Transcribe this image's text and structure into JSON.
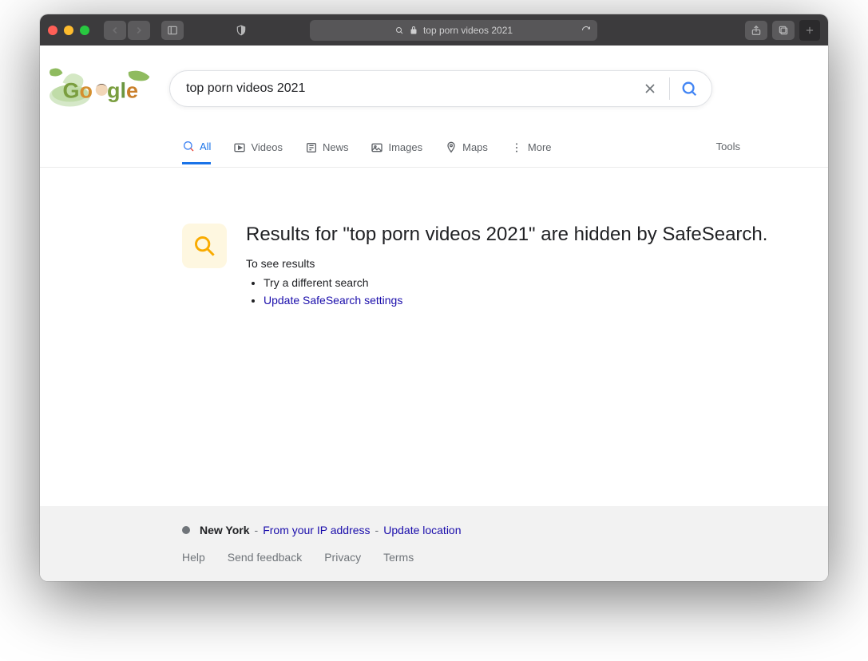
{
  "browser": {
    "address_text": "top porn videos 2021"
  },
  "search": {
    "query": "top porn videos 2021"
  },
  "tabs": {
    "all": "All",
    "videos": "Videos",
    "news": "News",
    "images": "Images",
    "maps": "Maps",
    "more": "More",
    "tools": "Tools"
  },
  "safesearch": {
    "heading": "Results for \"top porn videos 2021\" are hidden by SafeSearch.",
    "sub": "To see results",
    "bullet1": "Try a different search",
    "bullet2": "Update SafeSearch settings"
  },
  "footer": {
    "location": "New York",
    "sep": " - ",
    "ip_link": "From your IP address",
    "sep2": " - ",
    "update_link": "Update location",
    "help": "Help",
    "feedback": "Send feedback",
    "privacy": "Privacy",
    "terms": "Terms"
  }
}
